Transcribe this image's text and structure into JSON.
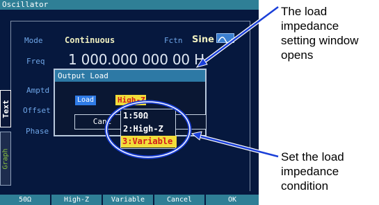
{
  "screen": {
    "title": "Oscillator",
    "side_tabs": {
      "text": "Text",
      "graph": "Graph"
    },
    "fields": [
      {
        "label": "Mode",
        "value": "Continuous"
      },
      {
        "label": "Fctn",
        "value": "Sine"
      },
      {
        "label": "Freq",
        "value": "1 000.000 000 00 H"
      },
      {
        "label": "Amptd"
      },
      {
        "label": "Offset"
      },
      {
        "label": "Phase"
      }
    ],
    "icons": {
      "fctn_waveform": "sine-wave-icon"
    }
  },
  "dialog": {
    "title": "Output Load",
    "load_label": "Load",
    "load_value": "High-Z",
    "cancel_label": "Cancel",
    "ok_label": "OK",
    "cancel_visible": "Canc",
    "dropdown_options": [
      "1:50Ω",
      "2:High-Z",
      "3:Variable"
    ],
    "dropdown_selected": "3:Variable"
  },
  "softkeys": [
    "50Ω",
    "High-Z",
    "Variable",
    "Cancel",
    "OK"
  ],
  "annotations": {
    "top": [
      "The load",
      "impedance",
      "setting window",
      "opens"
    ],
    "bottom": [
      "Set the load",
      "impedance",
      "condition"
    ]
  },
  "colors": {
    "screen_bg": "#06183e",
    "title_bar": "#2f7f96",
    "selection_yellow": "#f2dd3a",
    "selection_text_red": "#d11b1b",
    "callout_blue": "#1a3fd8"
  }
}
